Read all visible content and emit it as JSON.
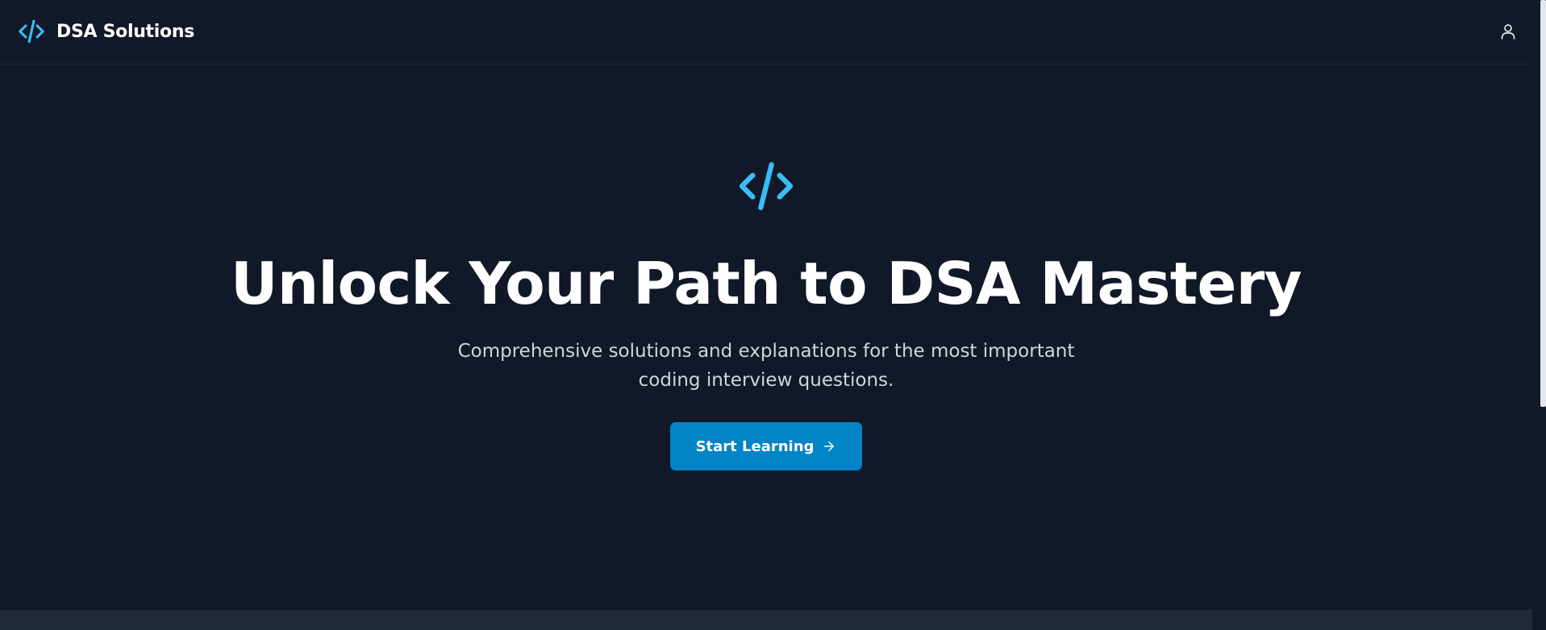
{
  "header": {
    "brand_name": "DSA Solutions",
    "brand_icon": "code-icon",
    "user_icon": "user-icon"
  },
  "hero": {
    "icon": "code-icon",
    "title": "Unlock Your Path to DSA Mastery",
    "subtitle": "Comprehensive solutions and explanations for the most important coding interview questions.",
    "cta_label": "Start Learning",
    "cta_icon": "arrow-right-icon"
  },
  "colors": {
    "background": "#111827",
    "accent": "#38bdf8",
    "button": "#0284c7",
    "text": "#ffffff",
    "muted_text": "#d1d5db"
  }
}
